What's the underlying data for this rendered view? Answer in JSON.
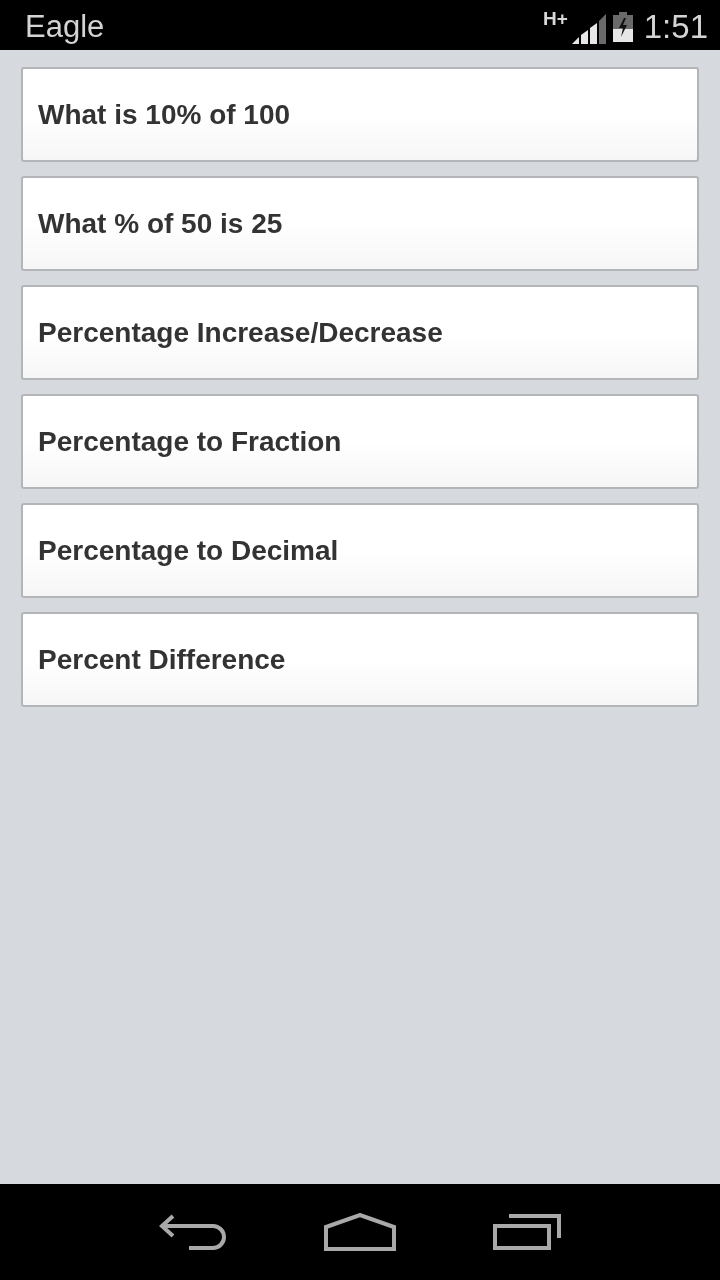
{
  "status_bar": {
    "title": "Eagle",
    "network": "H+",
    "time": "1:51"
  },
  "menu": {
    "items": [
      {
        "label": "What is 10% of 100"
      },
      {
        "label": "What % of 50 is 25"
      },
      {
        "label": "Percentage Increase/Decrease"
      },
      {
        "label": "Percentage to Fraction"
      },
      {
        "label": "Percentage to Decimal"
      },
      {
        "label": "Percent Difference"
      }
    ]
  }
}
